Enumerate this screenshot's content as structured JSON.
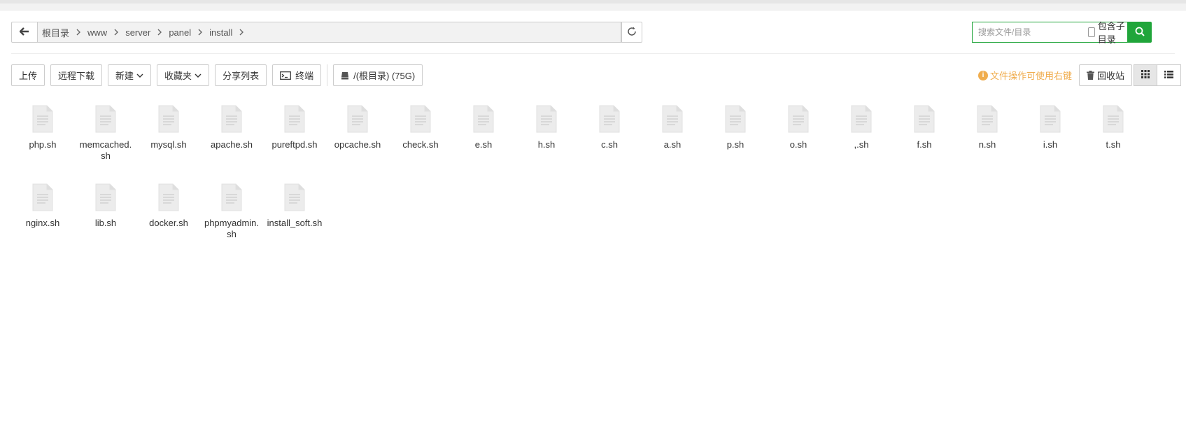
{
  "breadcrumbs": [
    "根目录",
    "www",
    "server",
    "panel",
    "install"
  ],
  "search": {
    "placeholder": "搜索文件/目录",
    "include_subdir_label": "包含子目录"
  },
  "toolbar": {
    "upload": "上传",
    "remote_download": "远程下载",
    "new": "新建",
    "favorites": "收藏夹",
    "share_list": "分享列表",
    "terminal": "终端",
    "disk": "/(根目录) (75G)"
  },
  "right": {
    "tip": "文件操作可使用右键",
    "recycle": "回收站"
  },
  "files": [
    {
      "name": "php.sh"
    },
    {
      "name": "memcached.sh"
    },
    {
      "name": "mysql.sh"
    },
    {
      "name": "apache.sh"
    },
    {
      "name": "pureftpd.sh"
    },
    {
      "name": "opcache.sh"
    },
    {
      "name": "check.sh"
    },
    {
      "name": "e.sh"
    },
    {
      "name": "h.sh"
    },
    {
      "name": "c.sh"
    },
    {
      "name": "a.sh"
    },
    {
      "name": "p.sh"
    },
    {
      "name": "o.sh"
    },
    {
      "name": ",.sh"
    },
    {
      "name": "f.sh"
    },
    {
      "name": "n.sh"
    },
    {
      "name": "i.sh"
    },
    {
      "name": "t.sh"
    },
    {
      "name": "nginx.sh"
    },
    {
      "name": "lib.sh"
    },
    {
      "name": "docker.sh"
    },
    {
      "name": "phpmyadmin.sh"
    },
    {
      "name": "install_soft.sh"
    }
  ],
  "colors": {
    "accent": "#20a53a",
    "tip": "#f0ad4e"
  },
  "icons": {
    "back": "arrow-left-icon",
    "refresh": "refresh-icon",
    "search": "search-icon",
    "file": "file-icon"
  }
}
